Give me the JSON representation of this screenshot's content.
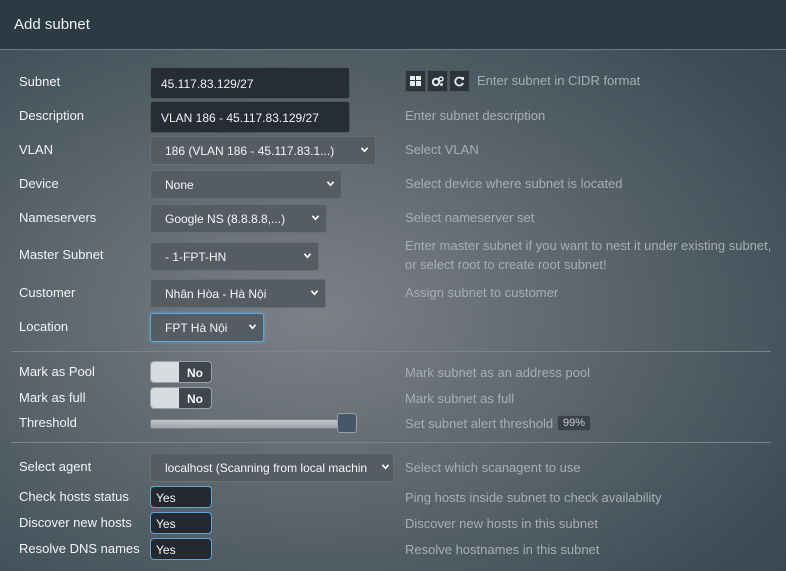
{
  "modal": {
    "title": "Add subnet"
  },
  "subnet": {
    "label": "Subnet",
    "value": "45.117.83.129/27",
    "hint": "Enter subnet in CIDR format",
    "buttons": [
      "table-icon",
      "cogs-icon",
      "refresh-icon"
    ]
  },
  "description": {
    "label": "Description",
    "value": "VLAN 186 - 45.117.83.129/27",
    "hint": "Enter subnet description"
  },
  "vlan": {
    "label": "VLAN",
    "selected": "186 (VLAN 186 - 45.117.83.1...)",
    "hint": "Select VLAN"
  },
  "device": {
    "label": "Device",
    "selected": "None",
    "hint": "Select device where subnet is located"
  },
  "nameservers": {
    "label": "Nameservers",
    "selected": "Google NS (8.8.8.8,...)",
    "hint": "Select nameserver set"
  },
  "master_subnet": {
    "label": "Master Subnet",
    "selected": "- 1-FPT-HN",
    "hint_line1": "Enter master subnet if you want to nest it under existing subnet,",
    "hint_line2": "or select root to create root subnet!"
  },
  "customer": {
    "label": "Customer",
    "selected": "Nhân Hòa - Hà Nội",
    "hint": "Assign subnet to customer"
  },
  "location": {
    "label": "Location",
    "selected": "FPT Hà Nội"
  },
  "mark_pool": {
    "label": "Mark as Pool",
    "state": "No",
    "hint": "Mark subnet as an address pool"
  },
  "mark_full": {
    "label": "Mark as full",
    "state": "No",
    "hint": "Mark subnet as full"
  },
  "threshold": {
    "label": "Threshold",
    "value_percent": 99,
    "badge": "99%",
    "hint": "Set subnet alert threshold"
  },
  "agent": {
    "label": "Select agent",
    "selected": "localhost (Scanning from local machin",
    "hint": "Select which scanagent to use"
  },
  "check_hosts": {
    "label": "Check hosts status",
    "state": "Yes",
    "hint": "Ping hosts inside subnet to check availability"
  },
  "discover": {
    "label": "Discover new hosts",
    "state": "Yes",
    "hint": "Discover new hosts in this subnet"
  },
  "resolve_dns": {
    "label": "Resolve DNS names",
    "state": "Yes",
    "hint": "Resolve hostnames in this subnet"
  },
  "colors": {
    "header_bg": "#2c3a44",
    "focus": "#5fa5d5",
    "hint_text": "#a6afb5"
  }
}
